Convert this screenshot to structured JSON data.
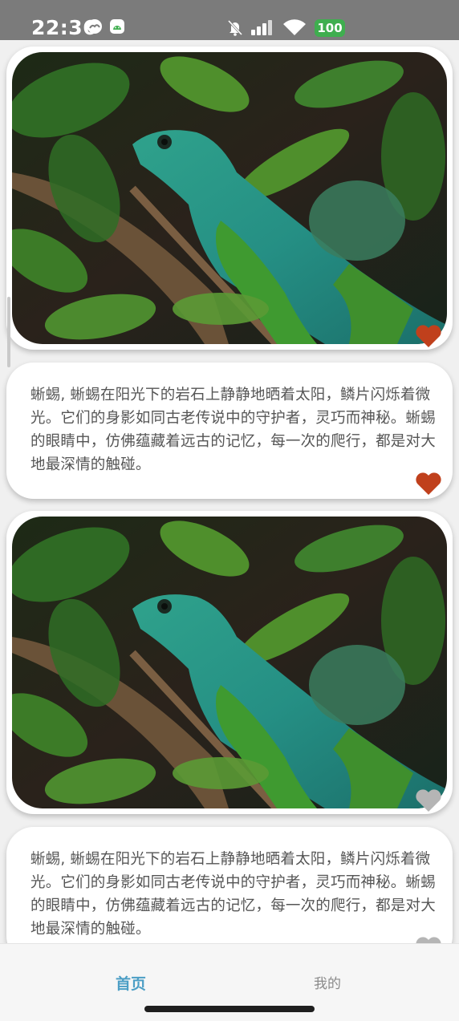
{
  "status_bar": {
    "time": "22:36",
    "battery": "100",
    "icons": [
      "weather-icon",
      "android-app-icon",
      "mute-bell-icon",
      "signal-icon",
      "wifi-icon",
      "battery-icon"
    ]
  },
  "feed": {
    "items": [
      {
        "image_alt": "lizard-photo",
        "image_liked": true,
        "text": "蜥蜴, 蜥蜴在阳光下的岩石上静静地晒着太阳，鳞片闪烁着微光。它们的身影如同古老传说中的守护者，灵巧而神秘。蜥蜴的眼睛中，仿佛蕴藏着远古的记忆，每一次的爬行，都是对大地最深情的触碰。",
        "text_liked": true
      },
      {
        "image_alt": "lizard-photo",
        "image_liked": false,
        "text": "蜥蜴, 蜥蜴在阳光下的岩石上静静地晒着太阳，鳞片闪烁着微光。它们的身影如同古老传说中的守护者，灵巧而神秘。蜥蜴的眼睛中，仿佛蕴藏着远古的记忆，每一次的爬行，都是对大地最深情的触碰。",
        "text_liked": false
      }
    ]
  },
  "tabs": [
    {
      "label": "首页",
      "active": true
    },
    {
      "label": "我的",
      "active": false
    }
  ],
  "colors": {
    "liked": "#c0401c",
    "unliked": "#b5b5b5",
    "active_tab": "#4c9ec5",
    "status_bar": "#7b7b7b"
  }
}
